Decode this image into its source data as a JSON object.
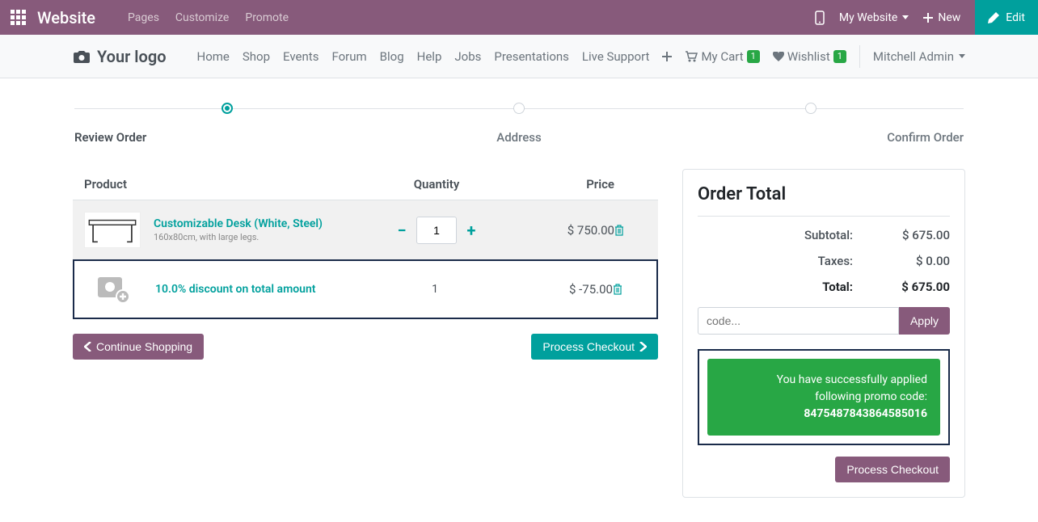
{
  "topnav": {
    "brand": "Website",
    "menu": [
      "Pages",
      "Customize",
      "Promote"
    ],
    "my_website": "My Website",
    "new": "New",
    "edit": "Edit"
  },
  "sitenav": {
    "logo": "Your logo",
    "items": [
      "Home",
      "Shop",
      "Events",
      "Forum",
      "Blog",
      "Help",
      "Jobs",
      "Presentations",
      "Live Support"
    ],
    "cart": "My Cart",
    "cart_count": "1",
    "wishlist": "Wishlist",
    "wishlist_count": "1",
    "user": "Mitchell Admin"
  },
  "wizard": {
    "step1": "Review Order",
    "step2": "Address",
    "step3": "Confirm Order"
  },
  "cart": {
    "headers": {
      "product": "Product",
      "quantity": "Quantity",
      "price": "Price"
    },
    "items": [
      {
        "name": "Customizable Desk (White, Steel)",
        "desc": "160x80cm, with large legs.",
        "qty": "1",
        "price": "$ 750.00"
      },
      {
        "name": "10.0% discount on total amount",
        "qty": "1",
        "price": "$ -75.00"
      }
    ],
    "continue": "Continue Shopping",
    "checkout": "Process Checkout"
  },
  "summary": {
    "title": "Order Total",
    "subtotal_lbl": "Subtotal:",
    "subtotal_val": "$ 675.00",
    "taxes_lbl": "Taxes:",
    "taxes_val": "$ 0.00",
    "total_lbl": "Total:",
    "total_val": "$ 675.00",
    "promo_placeholder": "code...",
    "apply": "Apply",
    "success_line1": "You have successfully applied",
    "success_line2": "following promo code:",
    "promo_code": "8475487843864585016",
    "checkout": "Process Checkout"
  }
}
